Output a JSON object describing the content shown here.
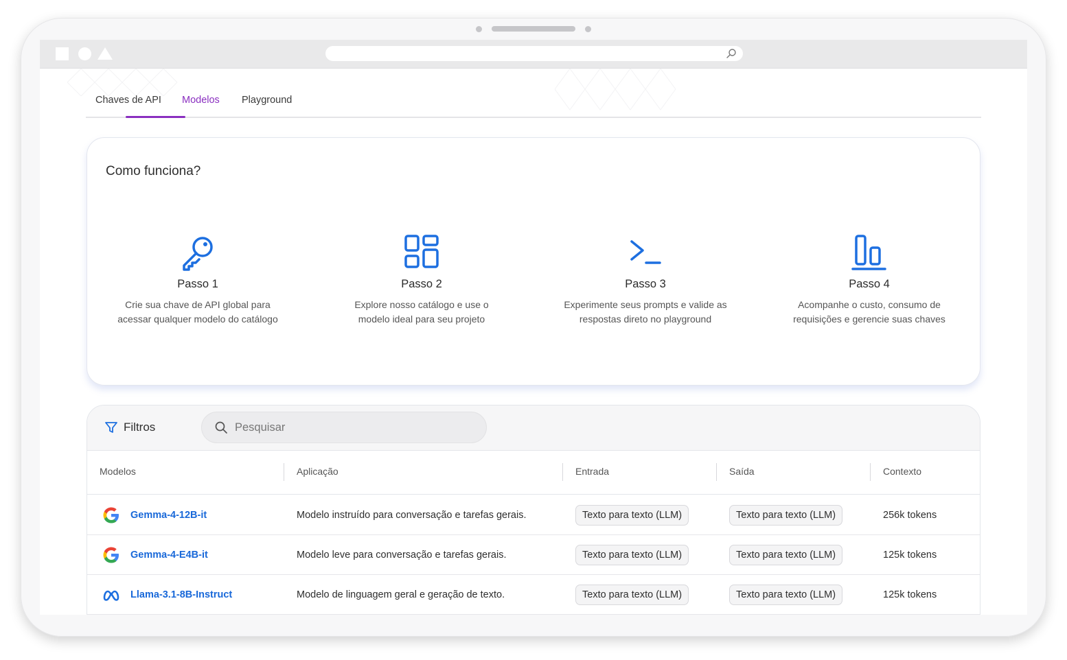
{
  "tabs": [
    {
      "label": "Chaves de API",
      "active": false
    },
    {
      "label": "Modelos",
      "active": true
    },
    {
      "label": "Playground",
      "active": false
    }
  ],
  "how": {
    "title": "Como funciona?",
    "steps": [
      {
        "icon": "key-icon",
        "title": "Passo 1",
        "desc_line1": "Crie sua chave de API global para",
        "desc_line2": "acessar qualquer modelo do catálogo"
      },
      {
        "icon": "grid-icon",
        "title": "Passo 2",
        "desc_line1": "Explore nosso catálogo e use o",
        "desc_line2": "modelo ideal para seu projeto"
      },
      {
        "icon": "terminal-icon",
        "title": "Passo 3",
        "desc_line1": "Experimente seus prompts e valide as",
        "desc_line2": "respostas direto no playground"
      },
      {
        "icon": "chart-icon",
        "title": "Passo 4",
        "desc_line1": "Acompanhe o custo, consumo de",
        "desc_line2": "requisições e gerencie suas chaves"
      }
    ]
  },
  "filters": {
    "label": "Filtros",
    "search_placeholder": "Pesquisar"
  },
  "table": {
    "headers": [
      "Modelos",
      "Aplicação",
      "Entrada",
      "Saída",
      "Contexto"
    ],
    "rows": [
      {
        "logo": "google-logo-icon",
        "model": "Gemma-4-12B-it",
        "application": "Modelo instruído para conversação e tarefas gerais.",
        "input": "Texto para texto (LLM)",
        "output": "Texto para texto (LLM)",
        "context": "256k tokens"
      },
      {
        "logo": "google-logo-icon",
        "model": "Gemma-4-E4B-it",
        "application": "Modelo leve para conversação e tarefas gerais.",
        "input": "Texto para texto (LLM)",
        "output": "Texto para texto (LLM)",
        "context": "125k tokens"
      },
      {
        "logo": "meta-logo-icon",
        "model": "Llama-3.1-8B-Instruct",
        "application": "Modelo de linguagem geral e geração de texto.",
        "input": "Texto para texto (LLM)",
        "output": "Texto para texto (LLM)",
        "context": "125k tokens"
      }
    ]
  },
  "colors": {
    "accent_purple": "#8a2fc0",
    "icon_blue": "#1d6fe0",
    "link_blue": "#1868d9"
  }
}
